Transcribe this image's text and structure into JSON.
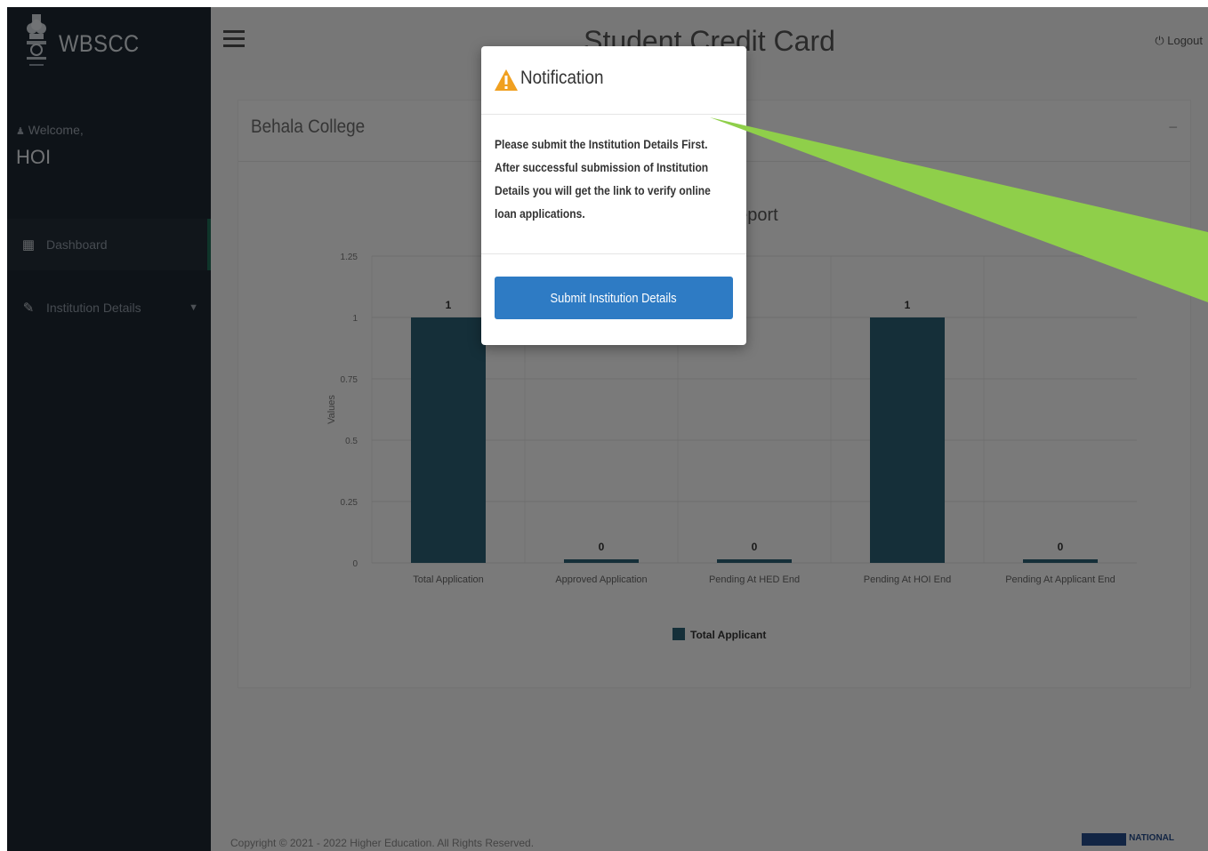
{
  "sidebar": {
    "logo_text": "WBSCC",
    "welcome_label": "Welcome,",
    "username": "HOI",
    "items": [
      {
        "label": "Dashboard",
        "icon": "dashboard-icon"
      },
      {
        "label": "Institution Details",
        "icon": "edit-icon"
      }
    ]
  },
  "header": {
    "title": "Student Credit Card",
    "logout_label": "Logout"
  },
  "panel": {
    "college_name": "Behala College"
  },
  "chart_data": {
    "type": "bar",
    "title": "Applications Report",
    "ylabel": "Values",
    "ylim": [
      0,
      1.25
    ],
    "yticks": [
      "0",
      "0.25",
      "0.5",
      "0.75",
      "1",
      "1.25"
    ],
    "categories": [
      "Total Application",
      "Approved Application",
      "Pending At HED End",
      "Pending At HOI End",
      "Pending At Applicant End"
    ],
    "series": [
      {
        "name": "Total Applicant",
        "values": [
          1,
          0,
          0,
          1,
          0
        ],
        "color": "#2a5f73"
      }
    ],
    "grid": true,
    "legend": "bottom"
  },
  "footer": {
    "copyright": "Copyright © 2021 - 2022 Higher Education. All Rights Reserved.",
    "nic_label": "NATIONAL"
  },
  "modal": {
    "title": "Notification",
    "icon": "warning-icon",
    "body_lines": [
      "Please submit the Institution Details First.",
      "After successful submission of Institution",
      "Details you will get the link to verify online",
      "loan applications."
    ],
    "button_label": "Submit Institution Details"
  },
  "colors": {
    "sidebar": "#1c2631",
    "accent": "#2e7bc4",
    "bar": "#2a5f73",
    "arrow": "#8fcf4a",
    "warning": "#f0a020"
  }
}
